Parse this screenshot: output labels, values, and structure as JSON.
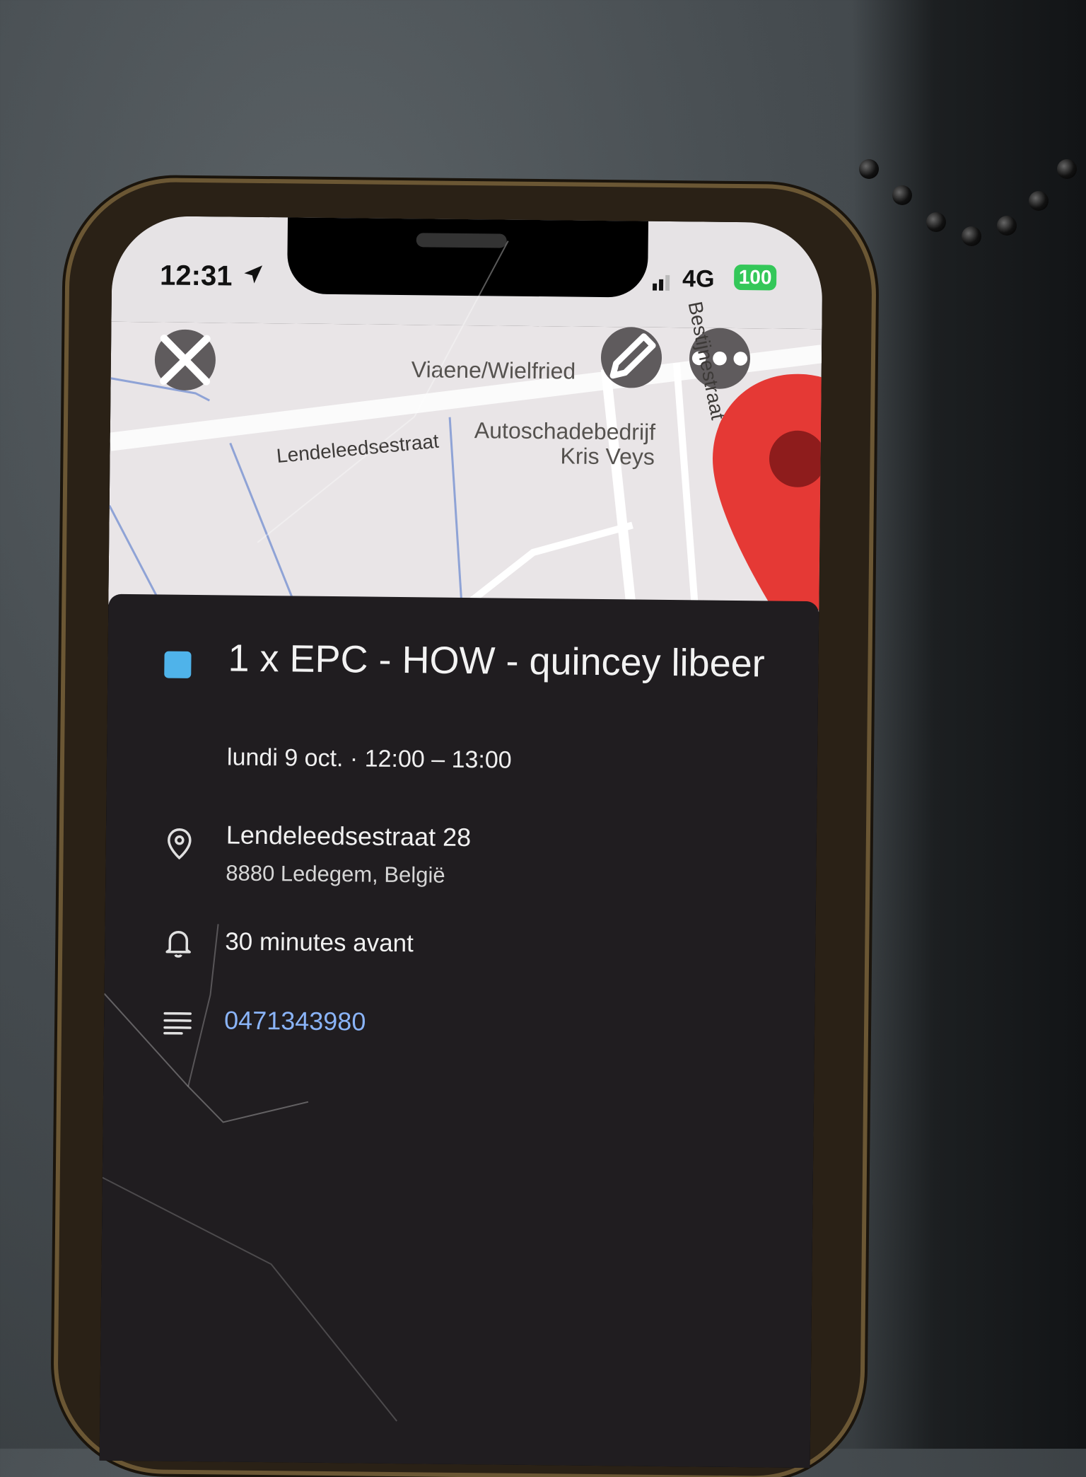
{
  "status_bar": {
    "time": "12:31",
    "network": "4G",
    "battery": "100"
  },
  "map": {
    "street_label": "Lendeleedsestraat",
    "poi_1": "Viaene/Wielfried",
    "poi_2_line1": "Autoschadebedrijf",
    "poi_2_line2": "Kris Veys",
    "side_street": "Bestijnestraat"
  },
  "event": {
    "color": "#4fb3ea",
    "title": "1 x EPC - HOW - quincey libeer",
    "date": "lundi 9 oct. · 12:00 – 13:00",
    "address_line1": "Lendeleedsestraat 28",
    "address_line2": "8880 Ledegem, België",
    "reminder": "30 minutes avant",
    "description": "0471343980"
  },
  "icons": {
    "close": "close-icon",
    "edit": "pencil-icon",
    "more": "more-icon",
    "location": "location-pin-icon",
    "reminder": "bell-icon",
    "description": "notes-icon"
  }
}
